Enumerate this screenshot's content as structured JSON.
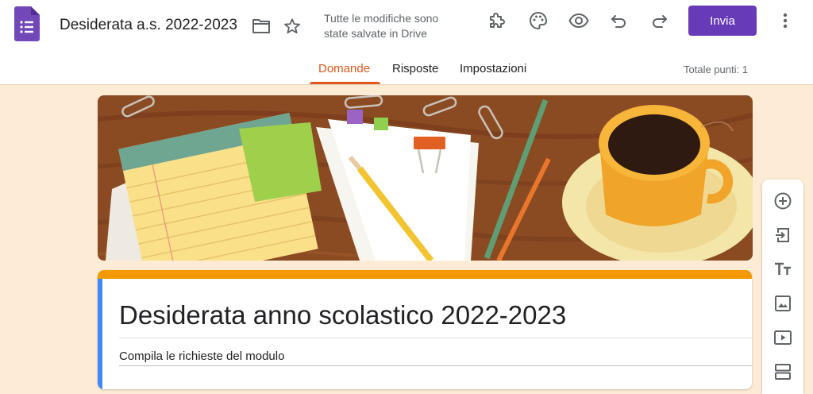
{
  "header": {
    "doc_title": "Desiderata a.s. 2022-2023",
    "save_status": "Tutte le modifiche sono state salvate in Drive",
    "send_label": "Invia",
    "icons": [
      "forms-logo-icon",
      "folder-icon",
      "star-icon",
      "addon-puzzle-icon",
      "palette-icon",
      "preview-eye-icon",
      "undo-icon",
      "redo-icon",
      "more-vert-icon"
    ]
  },
  "tabs": [
    {
      "label": "Domande",
      "active": true
    },
    {
      "label": "Risposte",
      "active": false
    },
    {
      "label": "Impostazioni",
      "active": false
    }
  ],
  "total_points": "Totale punti: 1",
  "form": {
    "title": "Desiderata anno scolastico 2022-2023",
    "description": "Compila le richieste del modulo"
  },
  "side_toolbar": [
    "add-question-icon",
    "import-questions-icon",
    "add-title-icon",
    "add-image-icon",
    "add-video-icon",
    "add-section-icon"
  ],
  "colors": {
    "accent_purple": "#673ab7",
    "tab_active": "#e0561b",
    "card_top": "#f29900",
    "card_left": "#4285f4",
    "background": "#fdebd5"
  }
}
